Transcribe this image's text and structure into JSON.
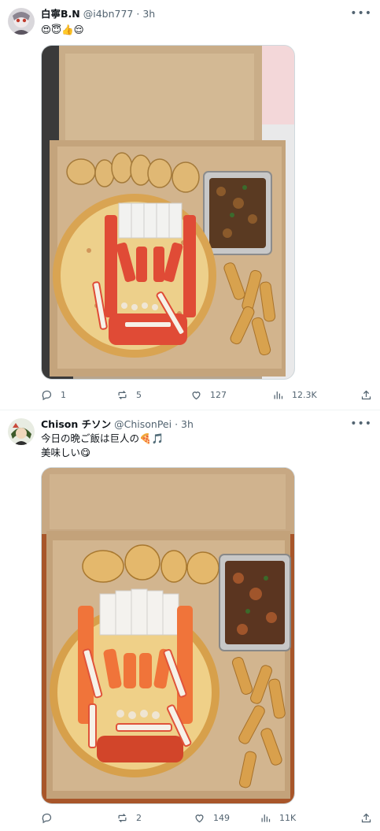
{
  "posts": [
    {
      "display_name": "白寧B.N",
      "handle": "@i4bn777",
      "time": "· 3h",
      "text": "😍😇👍😌",
      "replies": "1",
      "reposts": "5",
      "likes": "127",
      "views": "12.3K"
    },
    {
      "display_name": "Chison チソン",
      "handle": "@ChisonPei",
      "time": "· 3h",
      "text": "今日の晩ご飯は巨人の🍕🎵\n美味しい😋",
      "replies": "",
      "reposts": "2",
      "likes": "149",
      "views": "11K"
    }
  ],
  "icons": {
    "more": "more-icon",
    "reply": "reply-icon",
    "repost": "repost-icon",
    "like": "heart-icon",
    "views": "views-icon",
    "share": "share-icon"
  },
  "colors": {
    "text": "#0f1419",
    "secondary": "#536471",
    "divider": "#eff3f4"
  }
}
